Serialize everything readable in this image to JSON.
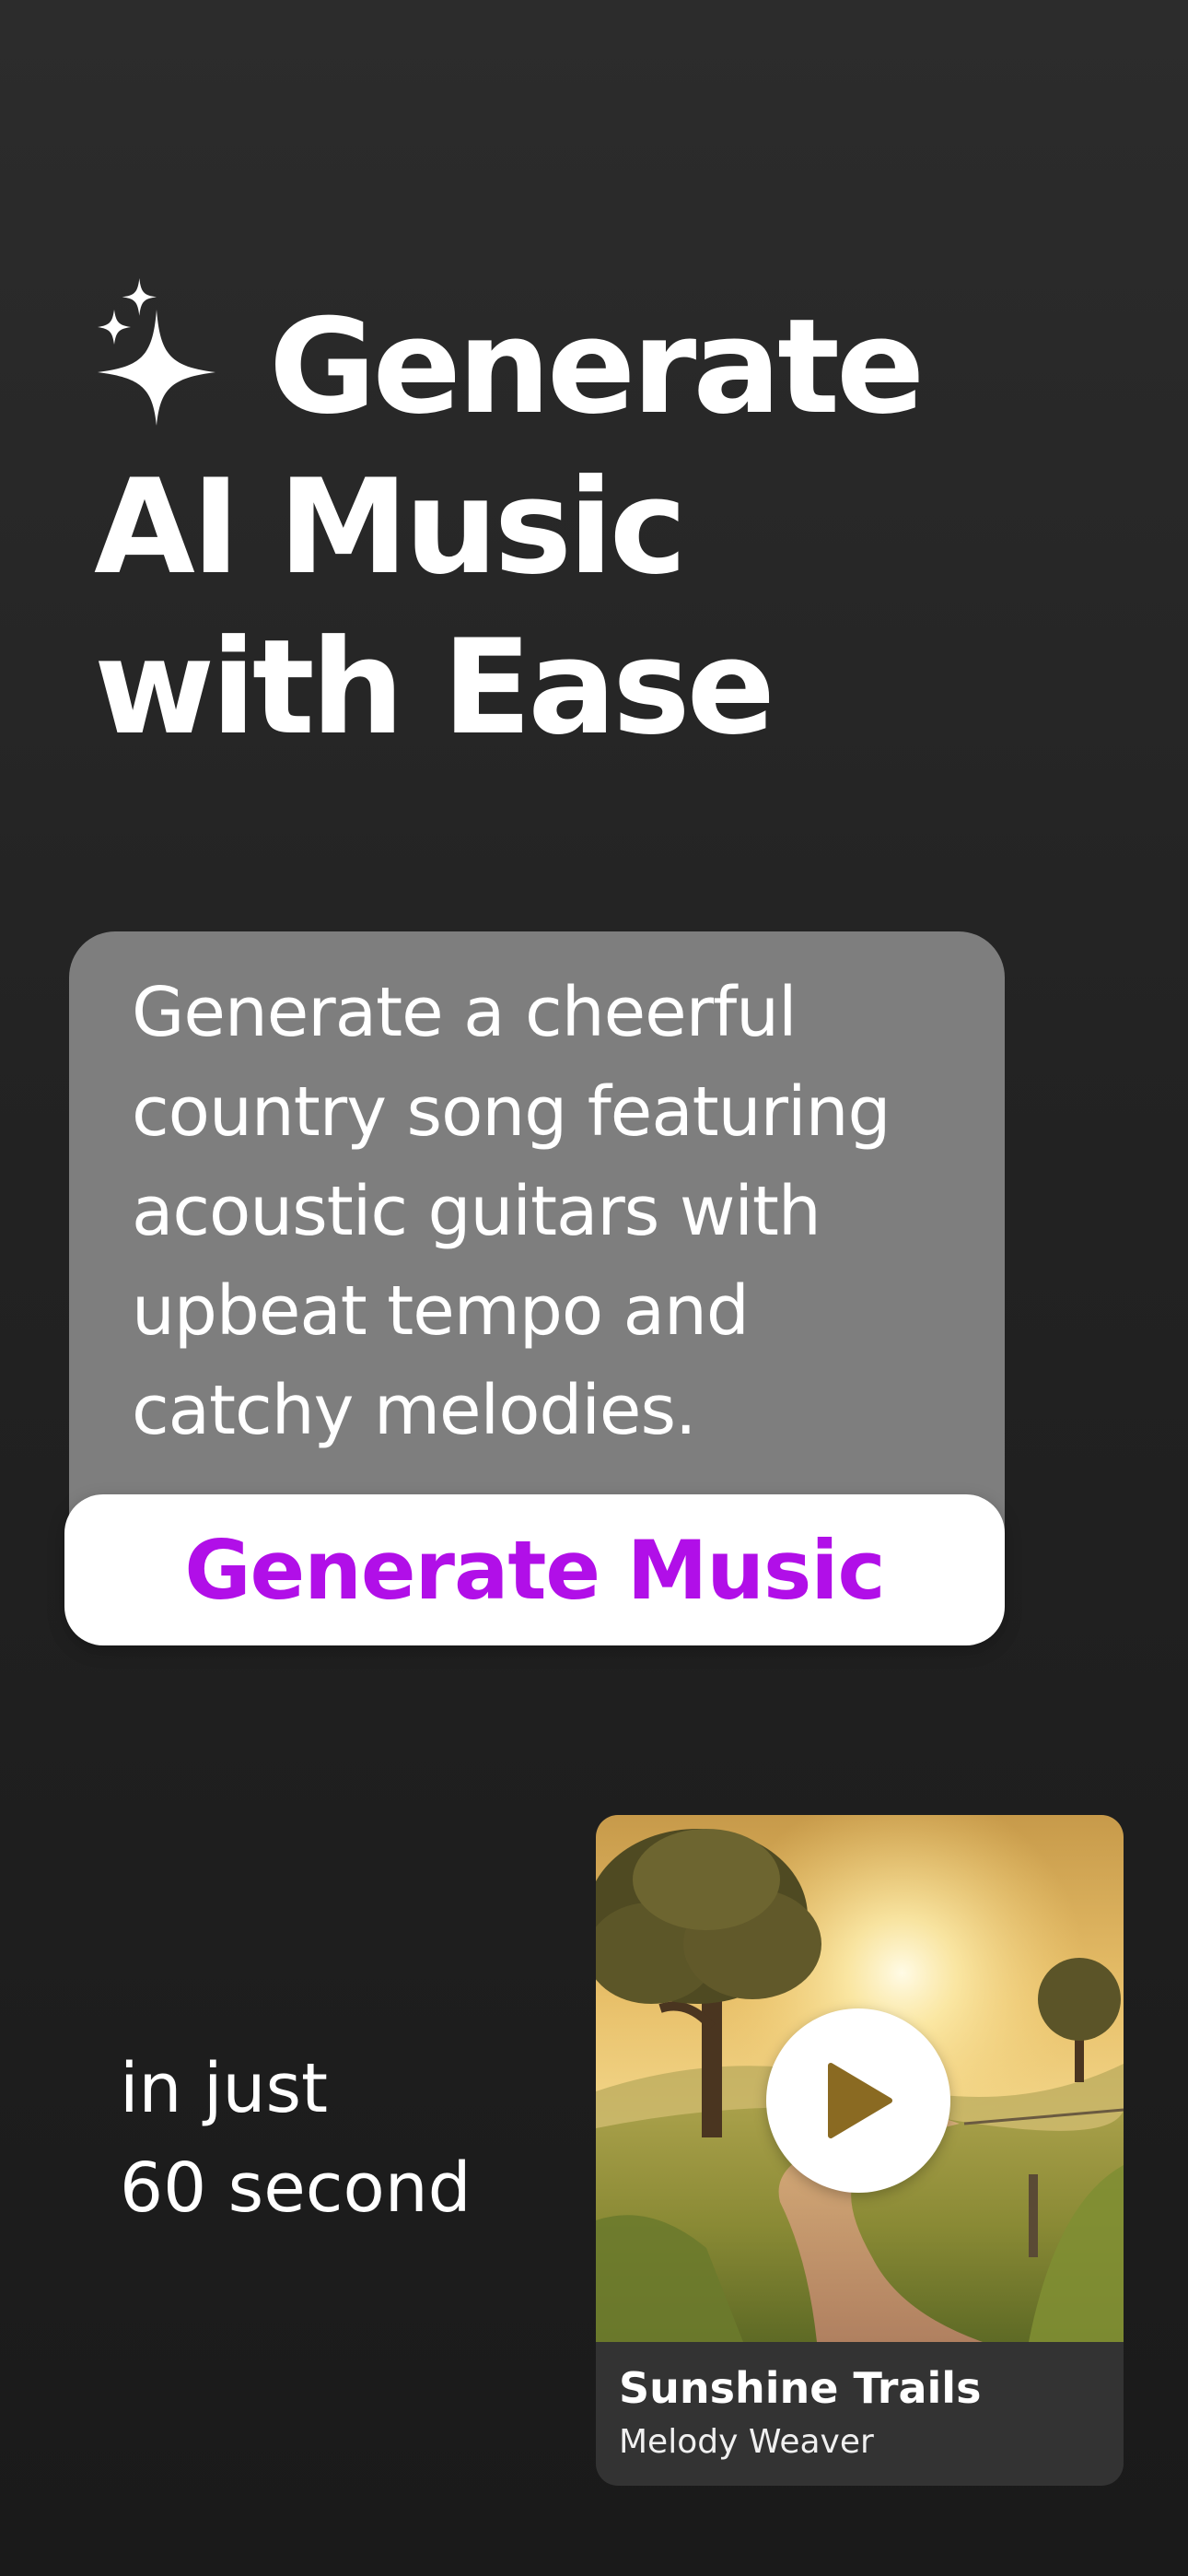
{
  "hero": {
    "headline_line1": "Generate",
    "headline_line2": "AI Music",
    "headline_line3": "with Ease",
    "icon": "sparkles-icon"
  },
  "prompt": {
    "text": "Generate a cheerful\ncountry song featuring\nacoustic guitars with\nupbeat tempo and\ncatchy melodies."
  },
  "generate_button": {
    "label": "Generate Music"
  },
  "tagline": {
    "text": "in just\n60 second"
  },
  "track": {
    "title": "Sunshine Trails",
    "artist": "Melody Weaver",
    "play_icon": "play-icon"
  },
  "colors": {
    "background": "#262626",
    "prompt_card": "#7e7e7e",
    "button_bg": "#ffffff",
    "button_text": "#b10fe8",
    "track_card": "#333333"
  }
}
